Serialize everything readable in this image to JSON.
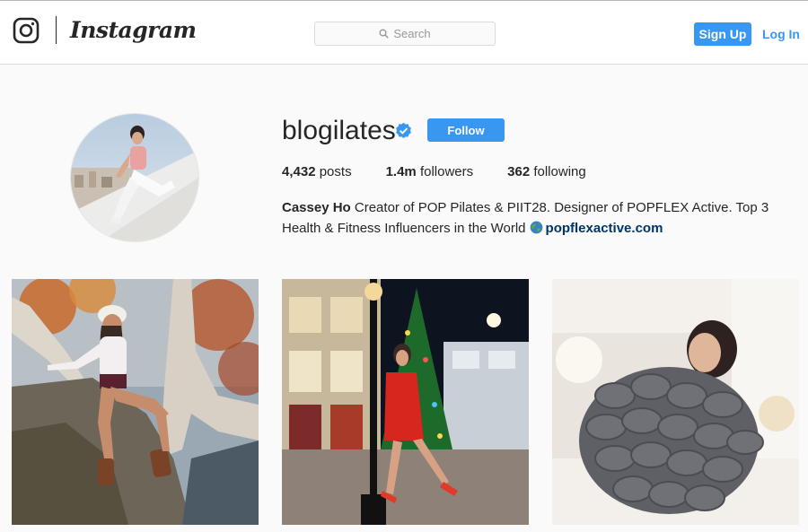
{
  "header": {
    "wordmark": "Instagram",
    "search_placeholder": "Search",
    "signup_label": "Sign Up",
    "login_label": "Log In"
  },
  "profile": {
    "username": "blogilates",
    "follow_label": "Follow",
    "stats": {
      "posts_count": "4,432",
      "posts_label": "posts",
      "followers_count": "1.4m",
      "followers_label": "followers",
      "following_count": "362",
      "following_label": "following"
    },
    "bio": {
      "name": "Cassey Ho",
      "text": "Creator of POP Pilates & PIIT28. Designer of POPFLEX Active. Top 3 Health & Fitness Influencers in the World",
      "link": "popflexactive.com"
    }
  },
  "colors": {
    "accent": "#3897f0",
    "link": "#003569",
    "text": "#262626",
    "background": "#fafafa"
  },
  "icons": {
    "logo": "instagram-camera-icon",
    "search": "search-icon",
    "verified": "verified-badge-icon",
    "globe": "globe-emoji-icon"
  }
}
